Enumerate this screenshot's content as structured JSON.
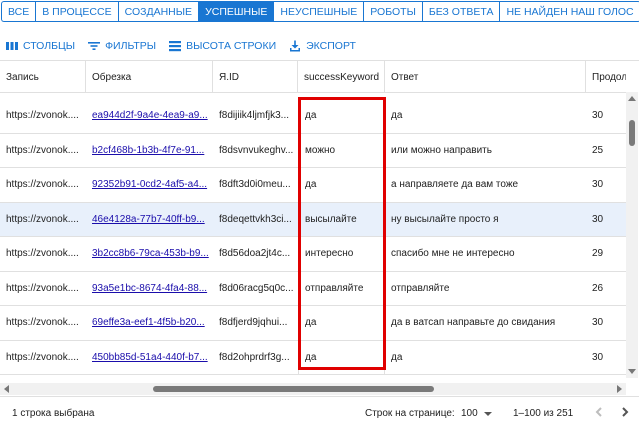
{
  "tabs": [
    {
      "label": "ВСЕ",
      "active": false
    },
    {
      "label": "В ПРОЦЕССЕ",
      "active": false
    },
    {
      "label": "СОЗДАННЫЕ",
      "active": false
    },
    {
      "label": "УСПЕШНЫЕ",
      "active": true
    },
    {
      "label": "НЕУСПЕШНЫЕ",
      "active": false
    },
    {
      "label": "РОБОТЫ",
      "active": false
    },
    {
      "label": "БЕЗ ОТВЕТА",
      "active": false
    },
    {
      "label": "НЕ НАЙДЕН НАШ ГОЛОС",
      "active": false
    }
  ],
  "toolbar": {
    "columns": "СТОЛБЦЫ",
    "filters": "ФИЛЬТРЫ",
    "row_height": "ВЫСОТА СТРОКИ",
    "export": "ЭКСПОРТ"
  },
  "columns": [
    "Запись",
    "Обрезка",
    "Я.ID",
    "successKeyword",
    "Ответ",
    "Продол..."
  ],
  "rows": [
    {
      "record": "https://zvonok....",
      "trim": "ea944d2f-9a4e-4ea9-a9...",
      "yid": "f8dijiik4ljmfjk3...",
      "keyword": "да",
      "answer": "да",
      "duration": "30"
    },
    {
      "record": "https://zvonok....",
      "trim": "b2cf468b-1b3b-4f7e-91...",
      "yid": "f8dsvnvukeghv...",
      "keyword": "можно",
      "answer": "или можно направить",
      "duration": "25"
    },
    {
      "record": "https://zvonok....",
      "trim": "92352b91-0cd2-4af5-a4...",
      "yid": "f8dft3d0i0meu...",
      "keyword": "да",
      "answer": "а направляете да вам тоже",
      "duration": "30"
    },
    {
      "record": "https://zvonok....",
      "trim": "46e4128a-77b7-40ff-b9...",
      "yid": "f8deqettvkh3ci...",
      "keyword": "высылайте",
      "answer": "ну высылайте просто я",
      "duration": "30"
    },
    {
      "record": "https://zvonok....",
      "trim": "3b2cc8b6-79ca-453b-b9...",
      "yid": "f8d56doa2jt4c...",
      "keyword": "интересно",
      "answer": "спасибо мне не интересно",
      "duration": "29"
    },
    {
      "record": "https://zvonok....",
      "trim": "93a5e1bc-8674-4fa4-88...",
      "yid": "f8d06racg5q0c...",
      "keyword": "отправляйте",
      "answer": "отправляйте",
      "duration": "26"
    },
    {
      "record": "https://zvonok....",
      "trim": "69effe3a-eef1-4f5b-b20...",
      "yid": "f8dfjerd9jqhui...",
      "keyword": "да",
      "answer": "да в ватсап направьте до свидания",
      "duration": "30"
    },
    {
      "record": "https://zvonok....",
      "trim": "450bb85d-51a4-440f-b7...",
      "yid": "f8d2ohprdrf3g...",
      "keyword": "да",
      "answer": "да",
      "duration": "30"
    }
  ],
  "selected_row_index": 3,
  "footer": {
    "selected": "1 строка выбрана",
    "rows_per_page_label": "Строк на странице:",
    "rows_per_page": "100",
    "range": "1–100 из 251"
  },
  "colors": {
    "accent": "#1976d2",
    "highlight": "#e00000",
    "selected_row": "#e8f0fb"
  }
}
